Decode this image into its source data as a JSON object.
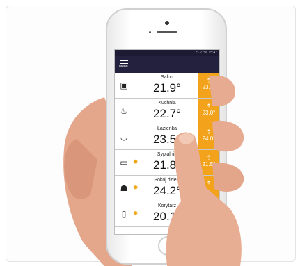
{
  "status_bar": {
    "signal": "⁺ᵢₗ",
    "battery": "77%",
    "time": "15:47"
  },
  "header": {
    "menu_label": "Menu"
  },
  "rooms": [
    {
      "name": "Salon",
      "temperature": "21.9°",
      "setpoint": "23.0°",
      "icon": "monitor-icon"
    },
    {
      "name": "Kuchnia",
      "temperature": "22.7°",
      "setpoint": "23.0°",
      "icon": "chef-icon"
    },
    {
      "name": "Łazienka",
      "temperature": "23.5°",
      "setpoint": "24.0°",
      "icon": "bathtub-icon"
    },
    {
      "name": "Sypialnia",
      "temperature": "21.8°",
      "setpoint": "21.5°",
      "icon": "bed-icon",
      "heating": true
    },
    {
      "name": "Pokój dzieci",
      "temperature": "24.2°",
      "setpoint": "",
      "icon": "children-icon",
      "heating": true
    },
    {
      "name": "Korytarz",
      "temperature": "20.1°",
      "setpoint": "",
      "icon": "door-icon",
      "heating": true
    }
  ],
  "colors": {
    "accent": "#f2a31b",
    "header": "#23213d"
  }
}
